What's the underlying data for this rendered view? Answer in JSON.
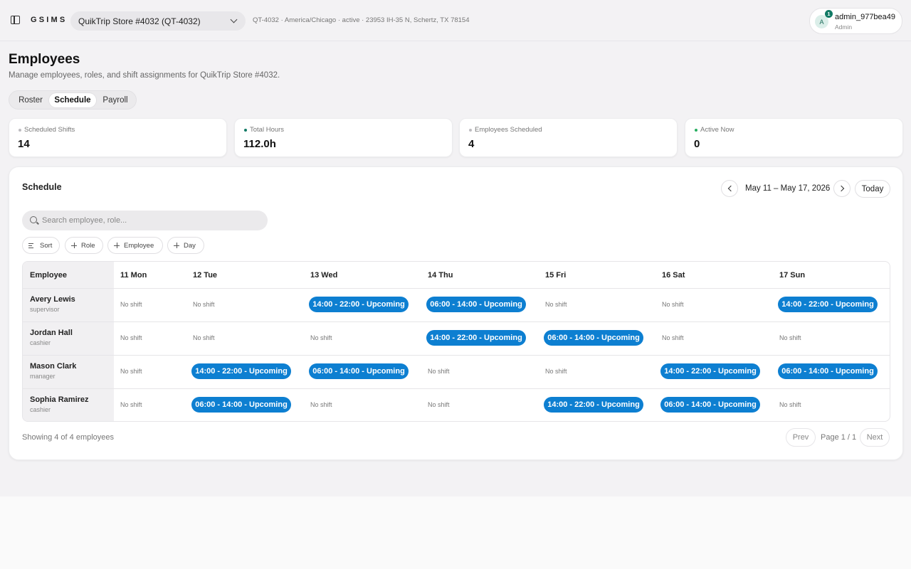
{
  "app": {
    "brand": "GSIMS"
  },
  "store": {
    "selected": "QuikTrip Store #4032 (QT-4032)",
    "meta": "QT-4032 · America/Chicago · active · 23953 IH-35 N, Schertz, TX 78154"
  },
  "user": {
    "initial": "A",
    "notifications": "1",
    "name": "admin_977bea49",
    "role": "Admin"
  },
  "page": {
    "title": "Employees",
    "subtitle": "Manage employees, roles, and shift assignments for QuikTrip Store #4032."
  },
  "tabs": [
    {
      "label": "Roster",
      "active": false
    },
    {
      "label": "Schedule",
      "active": true
    },
    {
      "label": "Payroll",
      "active": false
    }
  ],
  "stats": [
    {
      "label": "Scheduled Shifts",
      "value": "14",
      "dot_color": "#bdbcc0"
    },
    {
      "label": "Total Hours",
      "value": "112.0h",
      "dot_color": "#117a65"
    },
    {
      "label": "Employees Scheduled",
      "value": "4",
      "dot_color": "#bdbcc0"
    },
    {
      "label": "Active Now",
      "value": "0",
      "dot_color": "#27ae60"
    }
  ],
  "schedule": {
    "title": "Schedule",
    "range": "May 11 – May 17, 2026",
    "today_label": "Today",
    "search_placeholder": "Search employee, role...",
    "filters": {
      "sort": "Sort",
      "role": "Role",
      "employee": "Employee",
      "day": "Day"
    },
    "columns": [
      "Employee",
      "11 Mon",
      "12 Tue",
      "13 Wed",
      "14 Thu",
      "15 Fri",
      "16 Sat",
      "17 Sun"
    ],
    "empty_label": "No shift",
    "pill_color": "#0d7fd1",
    "rows": [
      {
        "name": "Avery Lewis",
        "role": "supervisor",
        "shifts": [
          "",
          "",
          "14:00 - 22:00 - Upcoming",
          "06:00 - 14:00 - Upcoming",
          "",
          "",
          "14:00 - 22:00 - Upcoming"
        ]
      },
      {
        "name": "Jordan Hall",
        "role": "cashier",
        "shifts": [
          "",
          "",
          "",
          "14:00 - 22:00 - Upcoming",
          "06:00 - 14:00 - Upcoming",
          "",
          ""
        ]
      },
      {
        "name": "Mason Clark",
        "role": "manager",
        "shifts": [
          "",
          "14:00 - 22:00 - Upcoming",
          "06:00 - 14:00 - Upcoming",
          "",
          "",
          "14:00 - 22:00 - Upcoming",
          "06:00 - 14:00 - Upcoming"
        ]
      },
      {
        "name": "Sophia Ramirez",
        "role": "cashier",
        "shifts": [
          "",
          "06:00 - 14:00 - Upcoming",
          "",
          "",
          "14:00 - 22:00 - Upcoming",
          "06:00 - 14:00 - Upcoming",
          ""
        ]
      }
    ],
    "footer": {
      "showing": "Showing 4 of 4 employees",
      "prev": "Prev",
      "page": "Page 1 / 1",
      "next": "Next"
    }
  }
}
